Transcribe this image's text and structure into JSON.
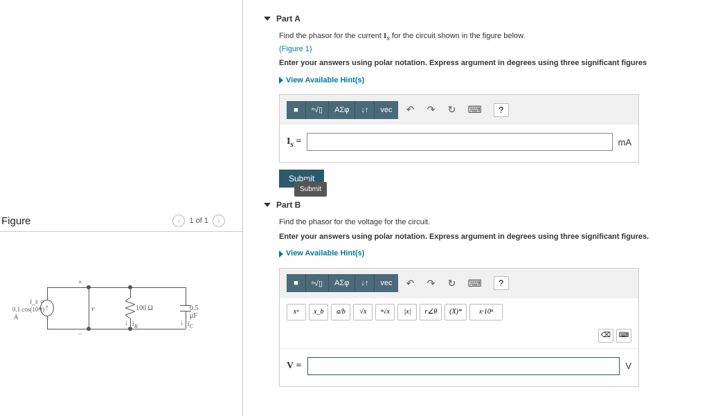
{
  "figure": {
    "heading": "Figure",
    "pager": "1 of 1",
    "source_label": "i_s =",
    "source_value": "0.1 cos(10⁴t)",
    "source_unit": "A",
    "v_label": "v",
    "plus": "+",
    "minus": "−",
    "r_label": "100 Ω",
    "c_label": "0.5 μF",
    "ir_label": "i_R",
    "ic_label": "i_C"
  },
  "partA": {
    "title": "Part A",
    "instr1": "Find the phasor for the current ",
    "instr1_var": "I_s",
    "instr1_end": " for the circuit shown in the figure below.",
    "figref": "(Figure 1)",
    "instr2": "Enter your answers using polar notation. Express argument in degrees using three significant figures",
    "hints": "View Available Hint(s)",
    "var": "I_s =",
    "unit": "mA",
    "submit": "Submit",
    "tooltip": "Submit"
  },
  "partB": {
    "title": "Part B",
    "instr1": "Find the phasor for the voltage for the circuit.",
    "instr2": "Enter your answers using polar notation. Express argument in degrees using three significant figures.",
    "hints": "View Available Hint(s)",
    "var": "V =",
    "unit": "V"
  },
  "toolbar": {
    "frac": "▯/▯",
    "sqrt": "ⁿ√▯",
    "greek": "ΑΣφ",
    "updown": "↓↑",
    "vec": "vec",
    "undo": "↶",
    "redo": "↷",
    "reset": "↻",
    "keyboard": "⌨",
    "help": "?"
  },
  "mathbar": {
    "xa": "xᵃ",
    "xb": "x_b",
    "ab": "a/b",
    "sqrt": "√x",
    "nsqrt": "ⁿ√x",
    "abs": "|x|",
    "angle": "r∠θ",
    "conj": "(X)*",
    "sci": "x·10ⁿ",
    "bksp": "⌫",
    "kb": "⌨"
  }
}
